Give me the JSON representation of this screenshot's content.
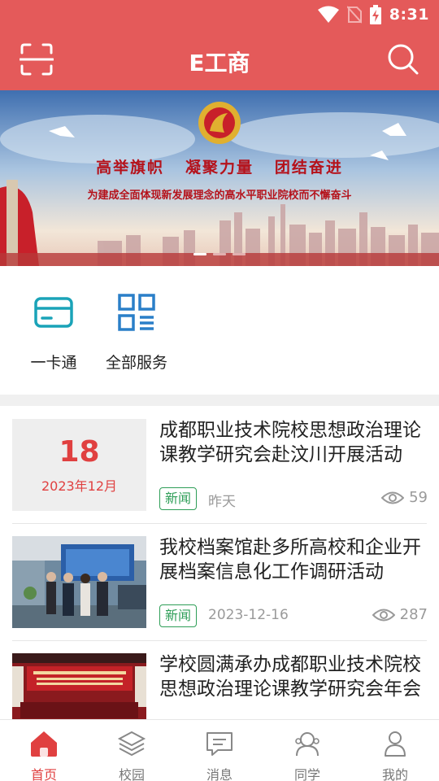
{
  "status_bar": {
    "time": "8:31"
  },
  "header": {
    "title": "E工商"
  },
  "banner": {
    "headline": "高举旗帜   凝聚力量   团结奋进",
    "subline": "为建成全面体现新发展理念的高水平职业院校而不懈奋斗"
  },
  "services": [
    {
      "label": "一卡通",
      "icon": "card-icon"
    },
    {
      "label": "全部服务",
      "icon": "grid-icon"
    }
  ],
  "news": [
    {
      "date_day": "18",
      "date_month": "2023年12月",
      "title": "成都职业技术院校思想政治理论课教学研究会赴汶川开展活动",
      "tag": "新闻",
      "date": "昨天",
      "views": "59"
    },
    {
      "title": "我校档案馆赴多所高校和企业开展档案信息化工作调研活动",
      "tag": "新闻",
      "date": "2023-12-16",
      "views": "287"
    },
    {
      "title": "学校圆满承办成都职业技术院校思想政治理论课教学研究会年会"
    }
  ],
  "tabs": [
    {
      "label": "首页",
      "icon": "home-icon"
    },
    {
      "label": "校园",
      "icon": "layers-icon"
    },
    {
      "label": "消息",
      "icon": "message-icon"
    },
    {
      "label": "同学",
      "icon": "classmates-icon"
    },
    {
      "label": "我的",
      "icon": "profile-icon"
    }
  ],
  "colors": {
    "primary": "#e45a5a",
    "accent_red": "#e04040",
    "tag_green": "#2e9e57",
    "service_icon": "#1aa3b8"
  }
}
